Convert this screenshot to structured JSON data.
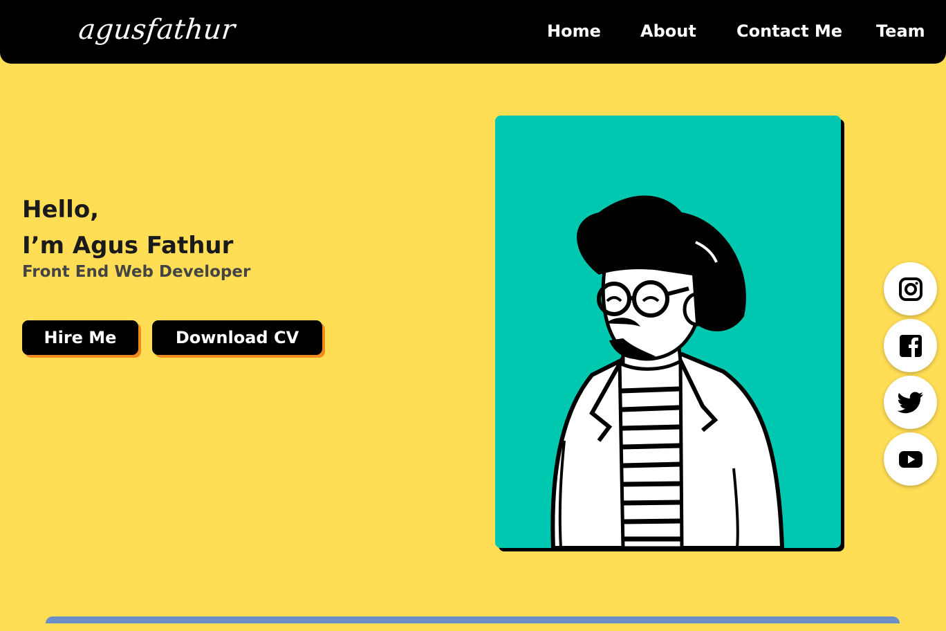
{
  "nav": {
    "logo": "agusfathur",
    "links": [
      "Home",
      "About",
      "Contact Me",
      "Team"
    ]
  },
  "hero": {
    "greeting_line1": "Hello,",
    "greeting_line2": "I’m Agus Fathur",
    "role": "Front End Web Developer",
    "buttons": {
      "hire": "Hire Me",
      "download": "Download CV"
    }
  },
  "social": [
    "instagram-icon",
    "facebook-icon",
    "twitter-icon",
    "youtube-icon"
  ],
  "colors": {
    "background": "#FFDD55",
    "navbar": "#000000",
    "accent_shadow": "#F08A1C",
    "portrait_bg": "#00C7B0",
    "bottom_bar": "#6B8EC6"
  }
}
